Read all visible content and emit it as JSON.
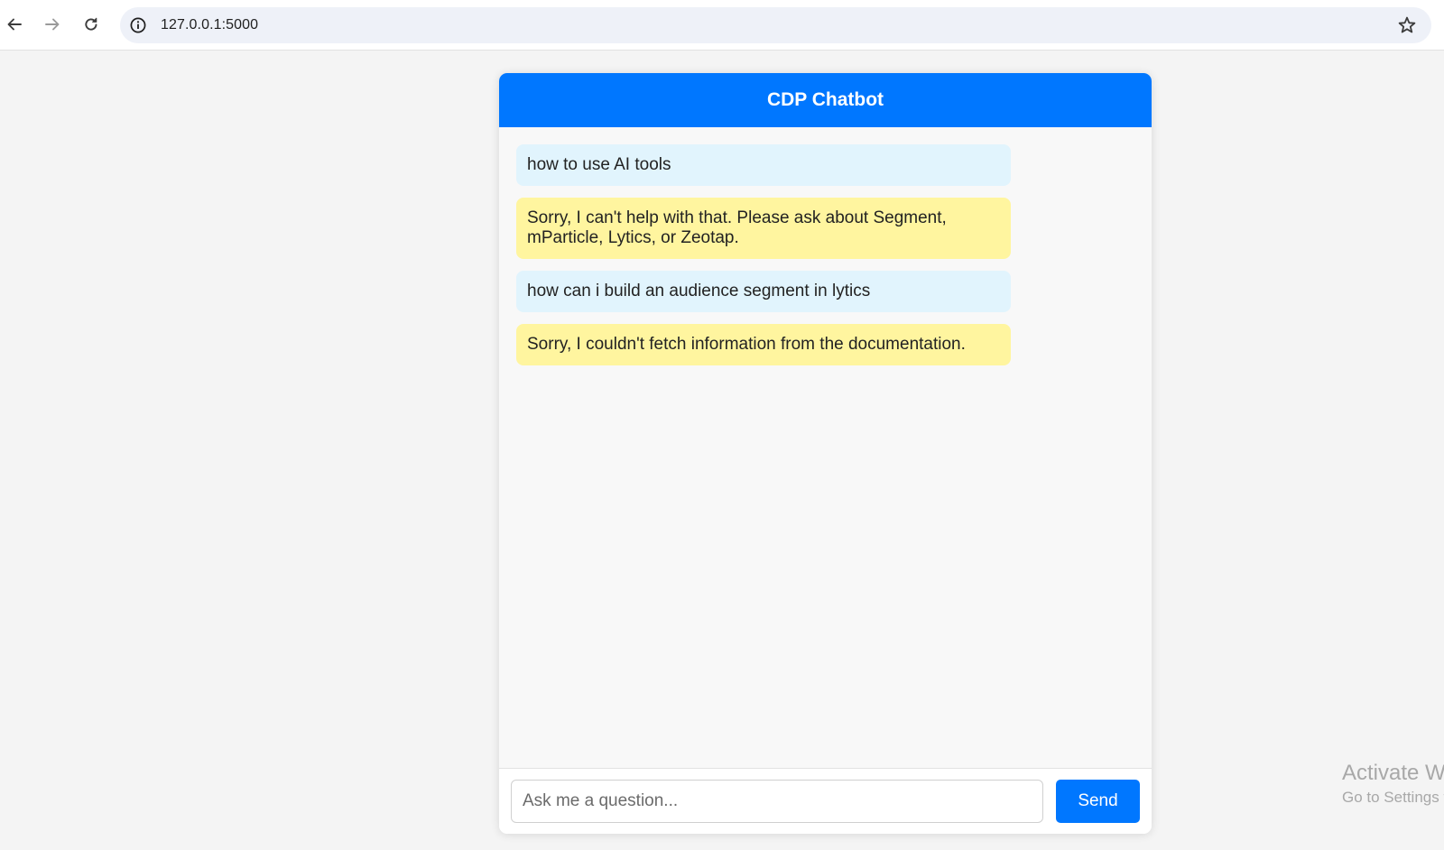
{
  "browser": {
    "url": "127.0.0.1:5000",
    "icons": {
      "back": "arrow-left-icon",
      "forward": "arrow-right-icon",
      "reload": "reload-icon",
      "info": "info-circle-icon",
      "bookmark": "star-icon"
    }
  },
  "chat": {
    "title": "CDP Chatbot",
    "messages": [
      {
        "role": "user",
        "text": "how to use AI tools"
      },
      {
        "role": "bot",
        "text": "Sorry, I can't help with that. Please ask about Segment, mParticle, Lytics, or Zeotap."
      },
      {
        "role": "user",
        "text": "how can i build an audience segment in lytics"
      },
      {
        "role": "bot",
        "text": "Sorry, I couldn't fetch information from the documentation."
      }
    ],
    "input": {
      "placeholder": "Ask me a question...",
      "value": ""
    },
    "send_label": "Send",
    "colors": {
      "header": "#0077ff",
      "user_bubble": "#e1f4fd",
      "bot_bubble": "#fff59f",
      "send_button": "#0077ff"
    }
  },
  "watermark": {
    "title": "Activate Windows",
    "subtitle": "Go to Settings to activate Windows."
  }
}
